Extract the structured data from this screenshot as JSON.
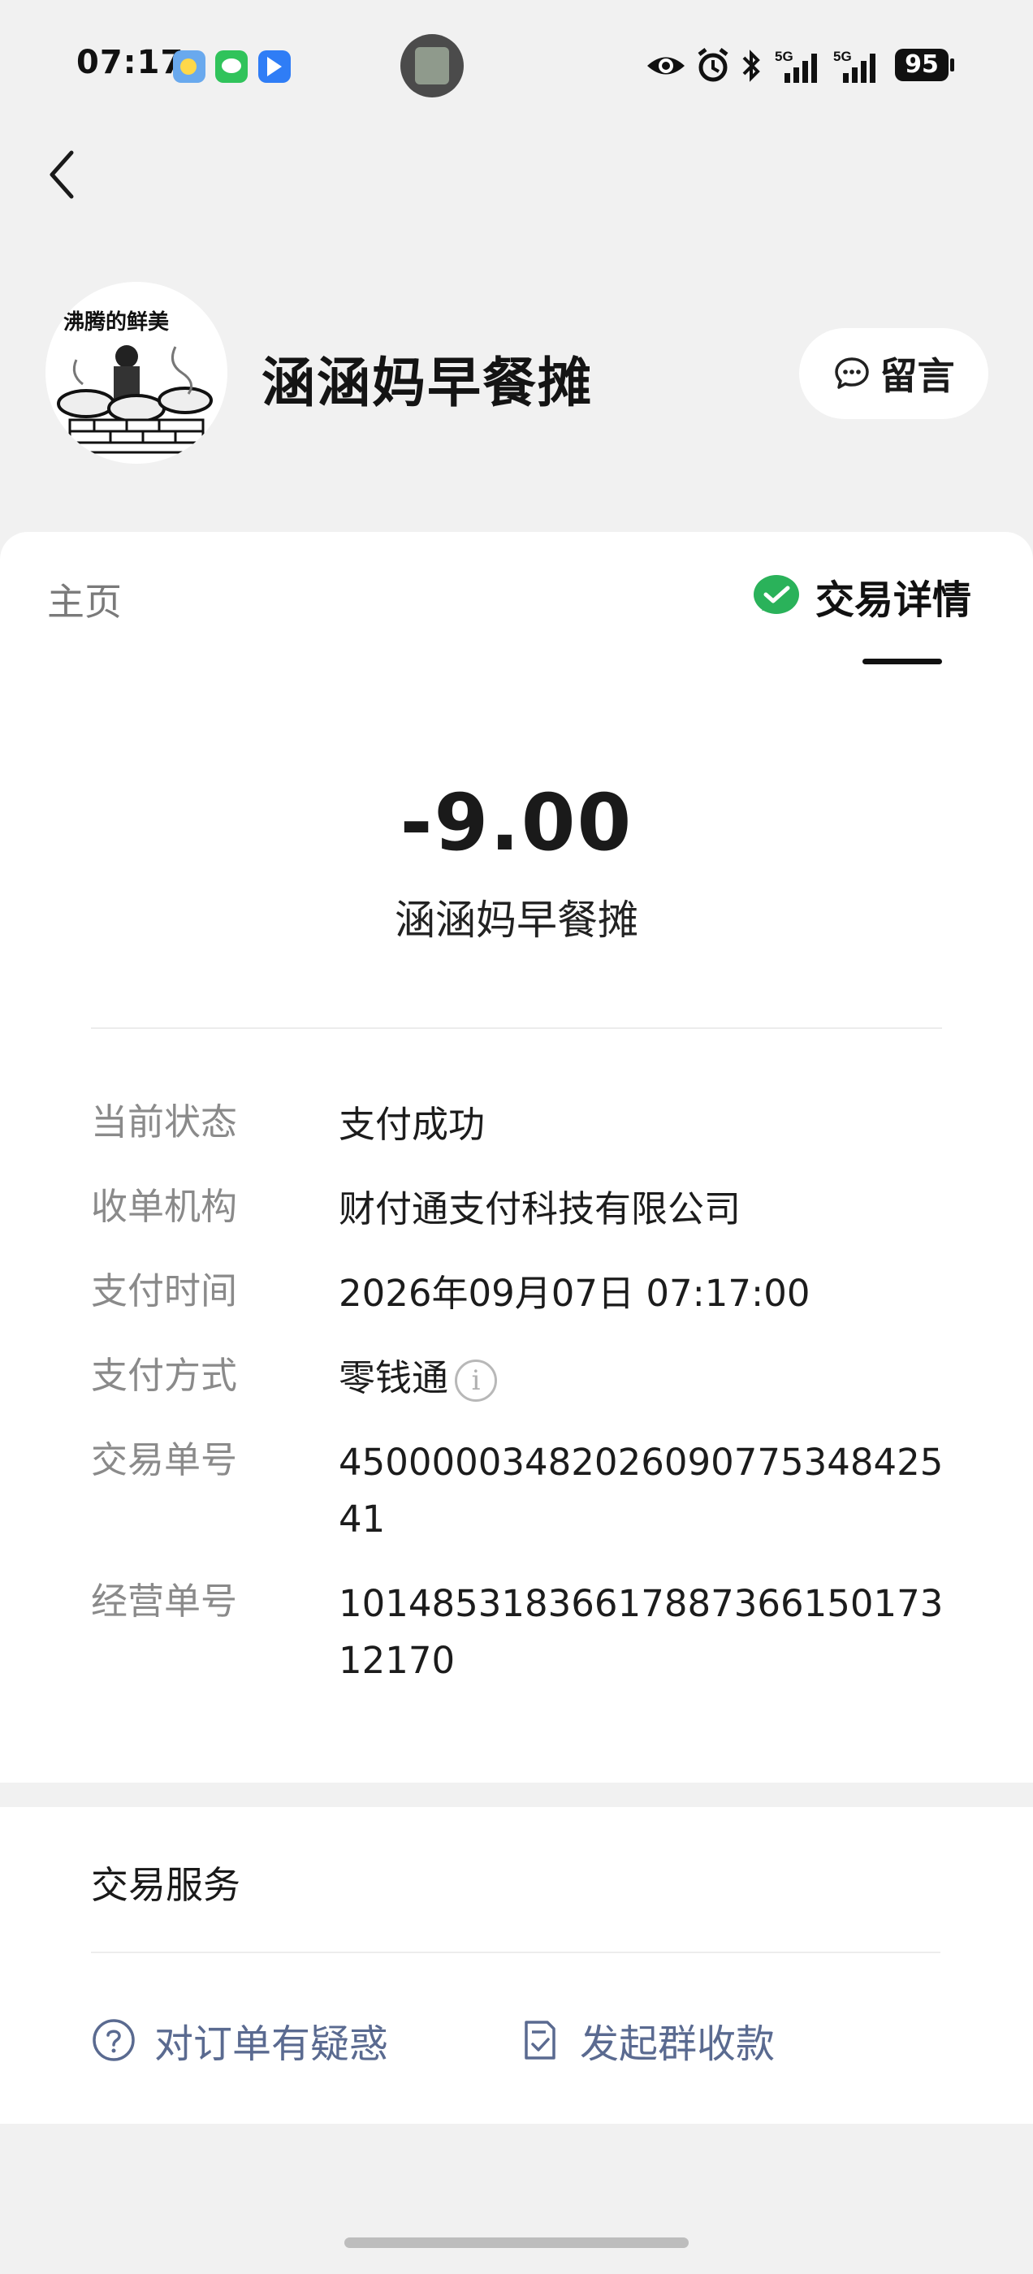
{
  "status_bar": {
    "time": "07:17",
    "battery": "95",
    "network_label": "5G",
    "icons": [
      "weather-app-icon",
      "wechat-icon",
      "bird-app-icon",
      "eye-icon",
      "alarm-icon",
      "bluetooth-icon",
      "signal-icon",
      "signal-icon",
      "battery-icon"
    ]
  },
  "header": {
    "back_icon": "chevron-left-icon",
    "merchant_name": "涵涵妈早餐摊",
    "avatar_text": "沸腾的鲜美",
    "message_button": "留言"
  },
  "tabs": {
    "home": "主页",
    "detail": "交易详情"
  },
  "transaction": {
    "amount": "-9.00",
    "merchant": "涵涵妈早餐摊",
    "fields": [
      {
        "label": "当前状态",
        "value": "支付成功"
      },
      {
        "label": "收单机构",
        "value": "财付通支付科技有限公司"
      },
      {
        "label": "支付时间",
        "value": "2026年09月07日 07:17:00"
      },
      {
        "label": "支付方式",
        "value": "零钱通"
      },
      {
        "label": "交易单号",
        "value": "4500000348202609077534842541"
      },
      {
        "label": "经营单号",
        "value": "1014853183661788736615017312170"
      }
    ]
  },
  "service": {
    "title": "交易服务",
    "question_action": "对订单有疑惑",
    "group_collect_action": "发起群收款"
  },
  "colors": {
    "page_bg": "#f1f1f1",
    "wechat_green": "#2ab25a",
    "link_blue_gray": "#5a6a90"
  }
}
